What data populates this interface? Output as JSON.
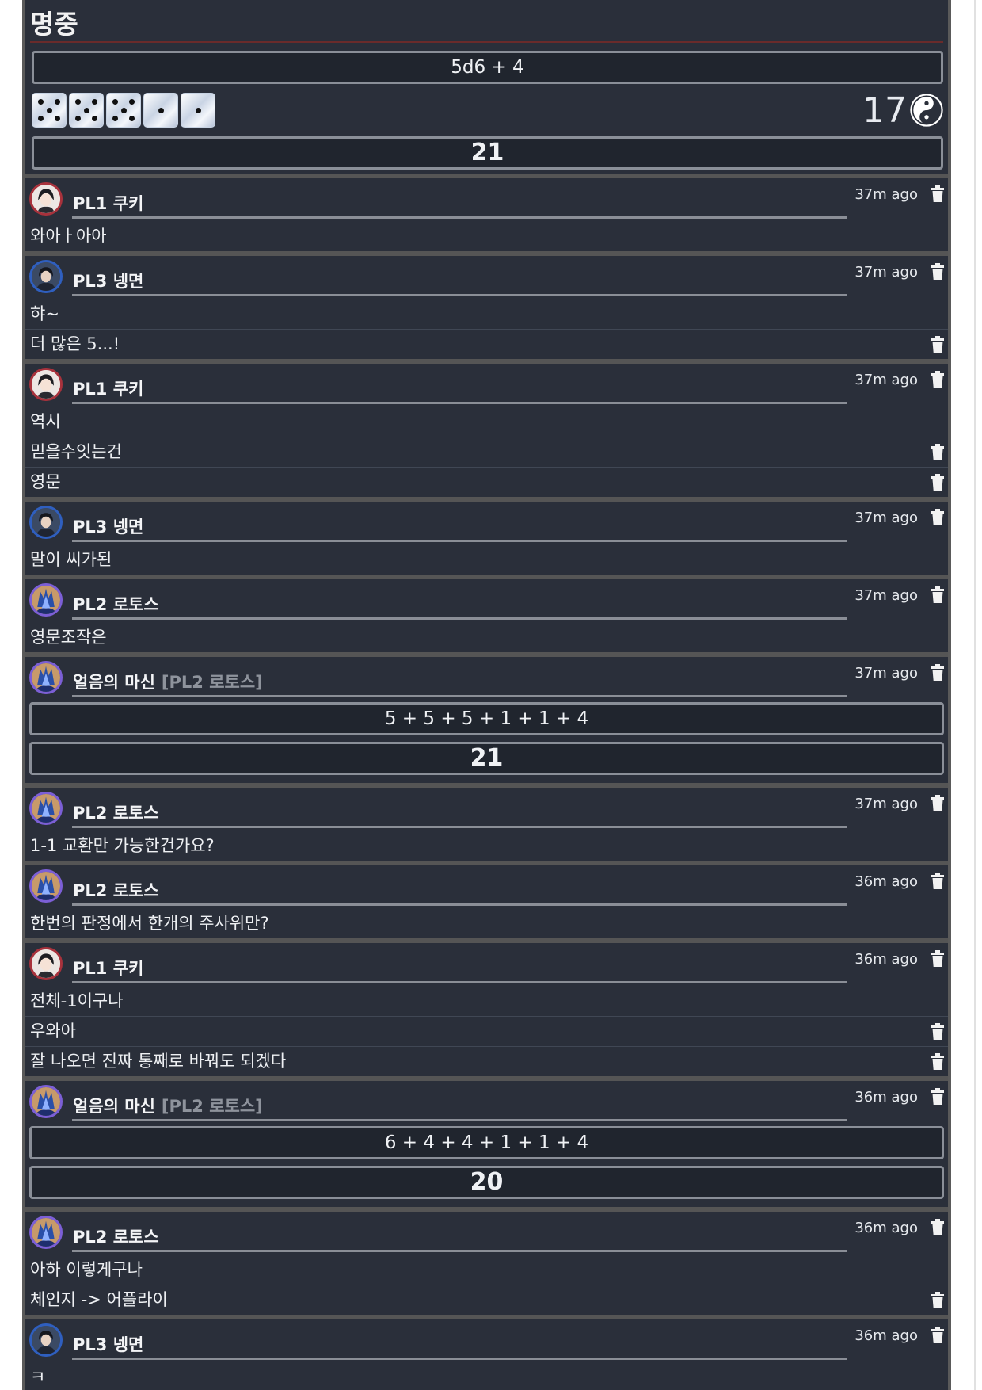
{
  "header": {
    "title": "명중",
    "expression": "5d6 + 4",
    "dice": [
      5,
      5,
      5,
      1,
      1
    ],
    "dice_sum": "17",
    "total": "21"
  },
  "icons": {
    "trash": "trash-icon",
    "reroll": "yinyang-icon"
  },
  "colors": {
    "background": "#2a2f3a",
    "pl1_ring": "#a8323c",
    "pl2_ring": "#7c5fd6",
    "pl3_ring": "#2f5fbf"
  },
  "messages": [
    {
      "sender": "PL1 쿠키",
      "avatar": "red",
      "time": "37m ago",
      "lines": [
        "와아ㅏ아아"
      ]
    },
    {
      "sender": "PL3 넹면",
      "avatar": "blue",
      "time": "37m ago",
      "lines": [
        "햐~",
        "더 많은 5...!"
      ]
    },
    {
      "sender": "PL1 쿠키",
      "avatar": "red",
      "time": "37m ago",
      "lines": [
        "역시",
        "믿을수잇는건",
        "영문"
      ]
    },
    {
      "sender": "PL3 넹면",
      "avatar": "blue",
      "time": "37m ago",
      "lines": [
        "말이 씨가된"
      ]
    },
    {
      "sender": "PL2 로토스",
      "avatar": "purple",
      "time": "37m ago",
      "lines": [
        "영문조작은"
      ]
    },
    {
      "sender": "얼음의 마신",
      "alias": "[PL2 로토스]",
      "avatar": "purple",
      "time": "37m ago",
      "roll": {
        "expression": "5 + 5 + 5 + 1 + 1 + 4",
        "total": "21"
      }
    },
    {
      "sender": "PL2 로토스",
      "avatar": "purple",
      "time": "37m ago",
      "lines": [
        "1-1 교환만 가능한건가요?"
      ]
    },
    {
      "sender": "PL2 로토스",
      "avatar": "purple",
      "time": "36m ago",
      "lines": [
        "한번의 판정에서 한개의 주사위만?"
      ]
    },
    {
      "sender": "PL1 쿠키",
      "avatar": "red",
      "time": "36m ago",
      "lines": [
        "전체-1이구나",
        "우와아",
        "잘 나오면 진짜 통째로 바꿔도 되겠다"
      ]
    },
    {
      "sender": "얼음의 마신",
      "alias": "[PL2 로토스]",
      "avatar": "purple",
      "time": "36m ago",
      "roll": {
        "expression": "6 + 4 + 4 + 1 + 1 + 4",
        "total": "20"
      }
    },
    {
      "sender": "PL2 로토스",
      "avatar": "purple",
      "time": "36m ago",
      "lines": [
        "아하 이렇게구나",
        "체인지 -> 어플라이"
      ]
    },
    {
      "sender": "PL3 넹면",
      "avatar": "blue",
      "time": "36m ago",
      "lines": [
        "ㅋ"
      ]
    }
  ]
}
